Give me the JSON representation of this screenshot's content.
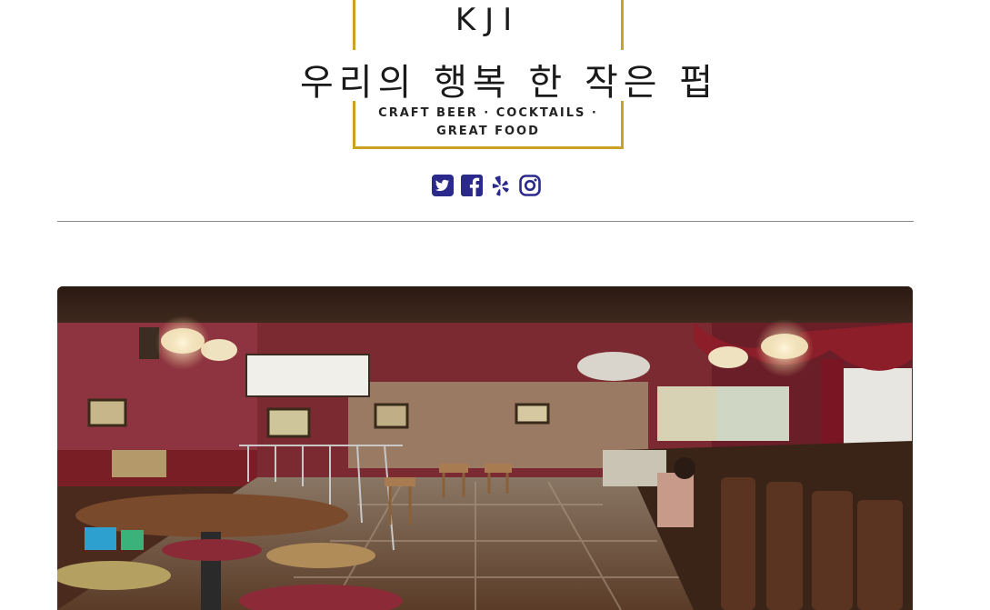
{
  "logo": {
    "wordmark": "KJI",
    "korean_title": "우리의 행복 한 작은 펍",
    "tagline_line1": "CRAFT BEER · COCKTAILS ·",
    "tagline_line2": "GREAT FOOD",
    "border_color": "#c9a227"
  },
  "social": {
    "icon_color": "#2b2a8c",
    "items": [
      {
        "name": "twitter-icon"
      },
      {
        "name": "facebook-icon"
      },
      {
        "name": "yelp-icon"
      },
      {
        "name": "instagram-icon"
      }
    ]
  },
  "hero": {
    "subject": "pub interior photo"
  }
}
